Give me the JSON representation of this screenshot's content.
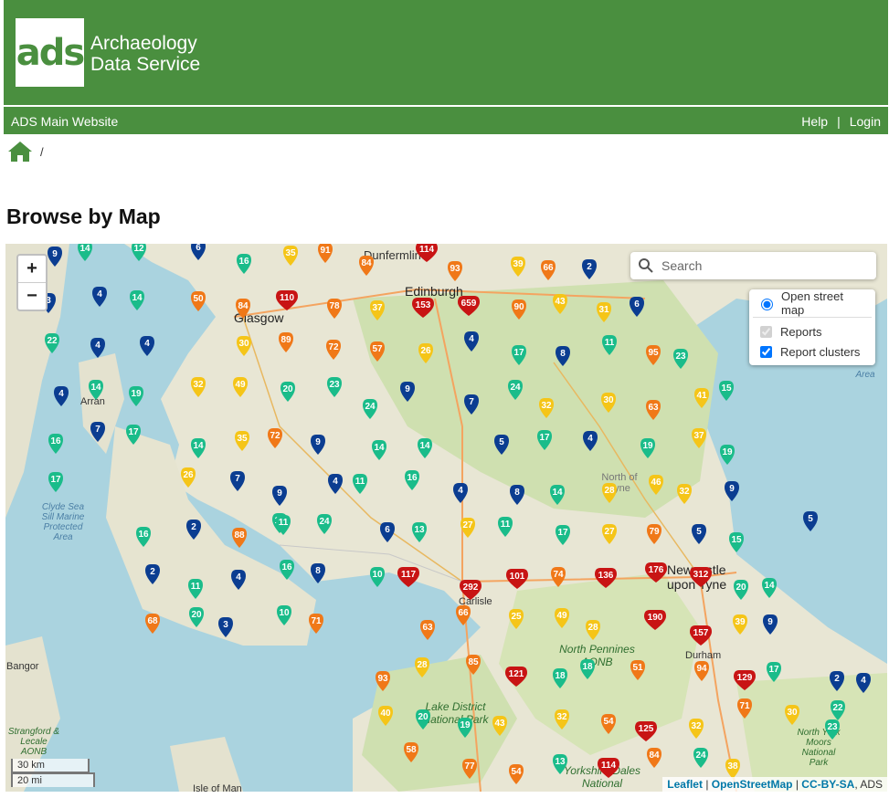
{
  "header": {
    "logo_text": "ads",
    "org_line1": "Archaeology",
    "org_line2": "Data Service",
    "brand_color": "#4a8f3f"
  },
  "nav": {
    "main_link": "ADS Main Website",
    "help": "Help",
    "separator": "|",
    "login": "Login"
  },
  "breadcrumb": {
    "separator": "/"
  },
  "page_title": "Browse by Map",
  "map": {
    "zoom_in": "+",
    "zoom_out": "−",
    "search_placeholder": "Search",
    "layers": {
      "base": "Open street map",
      "overlay1": "Reports",
      "overlay2": "Report clusters",
      "overlay1_checked": true,
      "overlay2_checked": true
    },
    "scale_km": "30 km",
    "scale_mi": "20 mi",
    "attribution": {
      "leaflet": "Leaflet",
      "sep": "|",
      "osm": "OpenStreetMap",
      "license": "CC-BY-SA",
      "ads": ", ADS"
    },
    "labels": [
      "Dunfermline",
      "Edinburgh",
      "Glasgow",
      "Arran",
      "Clyde Sea Sill Marine Protected Area",
      "North of Tyne",
      "Newcastle upon Tyne",
      "Carlisle",
      "North Pennines AONB",
      "Durham",
      "Bangor",
      "Strangford & Lecale AONB",
      "Lake District National Park",
      "Yorkshire Dales National",
      "North York Moors National Park",
      "Isle of Man",
      "Area"
    ],
    "clusters": [
      {
        "v": "9"
      },
      {
        "v": "14"
      },
      {
        "v": "12"
      },
      {
        "v": "6"
      },
      {
        "v": "16"
      },
      {
        "v": "35"
      },
      {
        "v": "91"
      },
      {
        "v": "114"
      },
      {
        "v": "84"
      },
      {
        "v": "93"
      },
      {
        "v": "39"
      },
      {
        "v": "66"
      },
      {
        "v": "2"
      },
      {
        "v": "3"
      },
      {
        "v": "4"
      },
      {
        "v": "14"
      },
      {
        "v": "50"
      },
      {
        "v": "84"
      },
      {
        "v": "110"
      },
      {
        "v": "78"
      },
      {
        "v": "37"
      },
      {
        "v": "153"
      },
      {
        "v": "659"
      },
      {
        "v": "90"
      },
      {
        "v": "43"
      },
      {
        "v": "31"
      },
      {
        "v": "6"
      },
      {
        "v": "22"
      },
      {
        "v": "4"
      },
      {
        "v": "4"
      },
      {
        "v": "30"
      },
      {
        "v": "89"
      },
      {
        "v": "72"
      },
      {
        "v": "57"
      },
      {
        "v": "26"
      },
      {
        "v": "4"
      },
      {
        "v": "17"
      },
      {
        "v": "8"
      },
      {
        "v": "11"
      },
      {
        "v": "95"
      },
      {
        "v": "23"
      },
      {
        "v": "4"
      },
      {
        "v": "14"
      },
      {
        "v": "19"
      },
      {
        "v": "32"
      },
      {
        "v": "49"
      },
      {
        "v": "20"
      },
      {
        "v": "23"
      },
      {
        "v": "9"
      },
      {
        "v": "24"
      },
      {
        "v": "15"
      },
      {
        "v": "41"
      },
      {
        "v": "7"
      },
      {
        "v": "17"
      },
      {
        "v": "24"
      },
      {
        "v": "7"
      },
      {
        "v": "32"
      },
      {
        "v": "30"
      },
      {
        "v": "63"
      },
      {
        "v": "16"
      },
      {
        "v": "14"
      },
      {
        "v": "35"
      },
      {
        "v": "72"
      },
      {
        "v": "9"
      },
      {
        "v": "14"
      },
      {
        "v": "14"
      },
      {
        "v": "5"
      },
      {
        "v": "17"
      },
      {
        "v": "4"
      },
      {
        "v": "19"
      },
      {
        "v": "37"
      },
      {
        "v": "19"
      },
      {
        "v": "17"
      },
      {
        "v": "26"
      },
      {
        "v": "7"
      },
      {
        "v": "9"
      },
      {
        "v": "4"
      },
      {
        "v": "11"
      },
      {
        "v": "16"
      },
      {
        "v": "4"
      },
      {
        "v": "8"
      },
      {
        "v": "14"
      },
      {
        "v": "28"
      },
      {
        "v": "46"
      },
      {
        "v": "32"
      },
      {
        "v": "9"
      },
      {
        "v": "13"
      },
      {
        "v": "11"
      },
      {
        "v": "24"
      },
      {
        "v": "6"
      },
      {
        "v": "13"
      },
      {
        "v": "27"
      },
      {
        "v": "11"
      },
      {
        "v": "17"
      },
      {
        "v": "27"
      },
      {
        "v": "79"
      },
      {
        "v": "5"
      },
      {
        "v": "5"
      },
      {
        "v": "16"
      },
      {
        "v": "2"
      },
      {
        "v": "88"
      },
      {
        "v": "15"
      },
      {
        "v": "2"
      },
      {
        "v": "4"
      },
      {
        "v": "16"
      },
      {
        "v": "8"
      },
      {
        "v": "10"
      },
      {
        "v": "117"
      },
      {
        "v": "292"
      },
      {
        "v": "101"
      },
      {
        "v": "74"
      },
      {
        "v": "136"
      },
      {
        "v": "176"
      },
      {
        "v": "312"
      },
      {
        "v": "20"
      },
      {
        "v": "14"
      },
      {
        "v": "11"
      },
      {
        "v": "20"
      },
      {
        "v": "3"
      },
      {
        "v": "10"
      },
      {
        "v": "71"
      },
      {
        "v": "66"
      },
      {
        "v": "25"
      },
      {
        "v": "49"
      },
      {
        "v": "28"
      },
      {
        "v": "190"
      },
      {
        "v": "39"
      },
      {
        "v": "9"
      },
      {
        "v": "68"
      },
      {
        "v": "63"
      },
      {
        "v": "157"
      },
      {
        "v": "28"
      },
      {
        "v": "85"
      },
      {
        "v": "121"
      },
      {
        "v": "18"
      },
      {
        "v": "18"
      },
      {
        "v": "51"
      },
      {
        "v": "94"
      },
      {
        "v": "129"
      },
      {
        "v": "17"
      },
      {
        "v": "2"
      },
      {
        "v": "4"
      },
      {
        "v": "93"
      },
      {
        "v": "71"
      },
      {
        "v": "30"
      },
      {
        "v": "22"
      },
      {
        "v": "40"
      },
      {
        "v": "20"
      },
      {
        "v": "19"
      },
      {
        "v": "43"
      },
      {
        "v": "32"
      },
      {
        "v": "54"
      },
      {
        "v": "125"
      },
      {
        "v": "32"
      },
      {
        "v": "23"
      },
      {
        "v": "58"
      },
      {
        "v": "84"
      },
      {
        "v": "24"
      },
      {
        "v": "77"
      },
      {
        "v": "54"
      },
      {
        "v": "13"
      },
      {
        "v": "114"
      },
      {
        "v": "38"
      }
    ],
    "colors": {
      "low": "#0b3d91",
      "mid": "#1abc8a",
      "midhigh": "#f5c518",
      "high": "#f07818",
      "top": "#c81414"
    }
  }
}
